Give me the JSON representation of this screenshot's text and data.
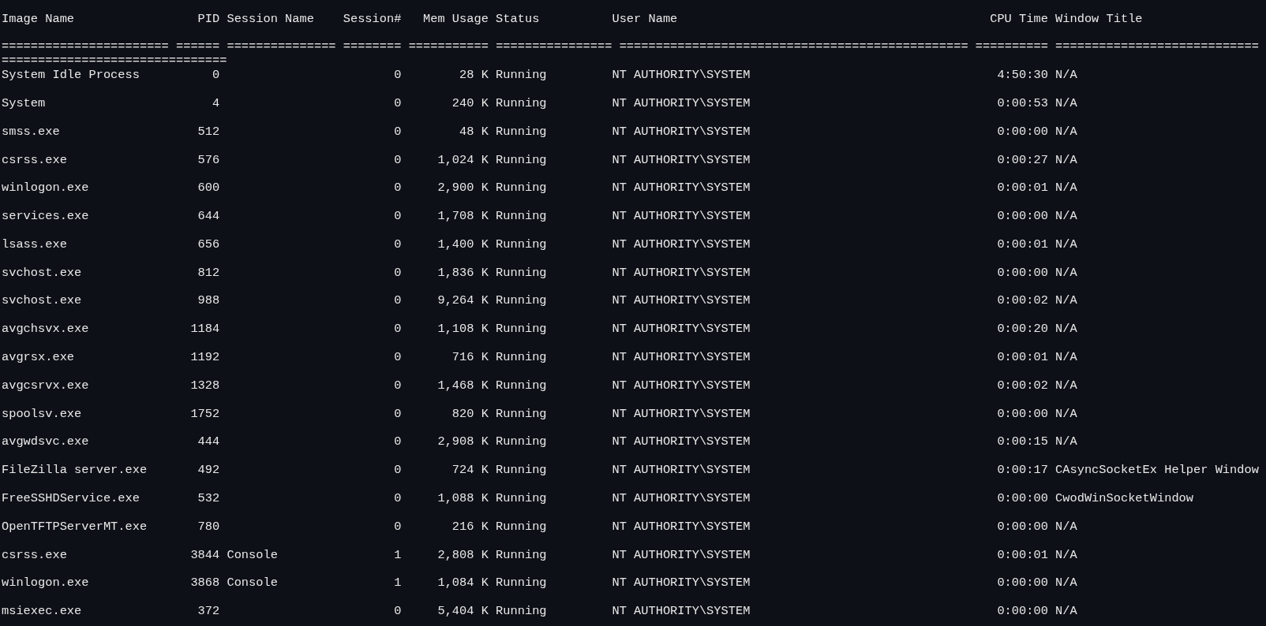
{
  "columns": [
    "Image Name",
    "PID",
    "Session Name",
    "Session#",
    "Mem Usage",
    "Status",
    "User Name",
    "CPU Time",
    "Window Title"
  ],
  "separator_lines": [
    "======================= ====== =============== ======== =========== ================ ================================================ ========== ============================",
    "==============================="
  ],
  "rows": [
    {
      "image_name": "System Idle Process",
      "pid": "0",
      "session_number": "0",
      "mem_usage": "28 K",
      "status": "Running",
      "user_name": "NT AUTHORITY\\SYSTEM",
      "cpu_time": "4:50:30",
      "window_title": "N/A"
    },
    {
      "image_name": "System",
      "pid": "4",
      "session_number": "0",
      "mem_usage": "240 K",
      "status": "Running",
      "user_name": "NT AUTHORITY\\SYSTEM",
      "cpu_time": "0:00:53",
      "window_title": "N/A"
    },
    {
      "image_name": "smss.exe",
      "pid": "512",
      "session_number": "0",
      "mem_usage": "48 K",
      "status": "Running",
      "user_name": "NT AUTHORITY\\SYSTEM",
      "cpu_time": "0:00:00",
      "window_title": "N/A"
    },
    {
      "image_name": "csrss.exe",
      "pid": "576",
      "session_number": "0",
      "mem_usage": "1,024 K",
      "status": "Running",
      "user_name": "NT AUTHORITY\\SYSTEM",
      "cpu_time": "0:00:27",
      "window_title": "N/A"
    },
    {
      "image_name": "winlogon.exe",
      "pid": "600",
      "session_number": "0",
      "mem_usage": "2,900 K",
      "status": "Running",
      "user_name": "NT AUTHORITY\\SYSTEM",
      "cpu_time": "0:00:01",
      "window_title": "N/A"
    },
    {
      "image_name": "services.exe",
      "pid": "644",
      "session_number": "0",
      "mem_usage": "1,708 K",
      "status": "Running",
      "user_name": "NT AUTHORITY\\SYSTEM",
      "cpu_time": "0:00:00",
      "window_title": "N/A"
    },
    {
      "image_name": "lsass.exe",
      "pid": "656",
      "session_number": "0",
      "mem_usage": "1,400 K",
      "status": "Running",
      "user_name": "NT AUTHORITY\\SYSTEM",
      "cpu_time": "0:00:01",
      "window_title": "N/A"
    },
    {
      "image_name": "svchost.exe",
      "pid": "812",
      "session_number": "0",
      "mem_usage": "1,836 K",
      "status": "Running",
      "user_name": "NT AUTHORITY\\SYSTEM",
      "cpu_time": "0:00:00",
      "window_title": "N/A"
    },
    {
      "image_name": "svchost.exe",
      "pid": "988",
      "session_number": "0",
      "mem_usage": "9,264 K",
      "status": "Running",
      "user_name": "NT AUTHORITY\\SYSTEM",
      "cpu_time": "0:00:02",
      "window_title": "N/A"
    },
    {
      "image_name": "avgchsvx.exe",
      "pid": "1184",
      "session_number": "0",
      "mem_usage": "1,108 K",
      "status": "Running",
      "user_name": "NT AUTHORITY\\SYSTEM",
      "cpu_time": "0:00:20",
      "window_title": "N/A"
    },
    {
      "image_name": "avgrsx.exe",
      "pid": "1192",
      "session_number": "0",
      "mem_usage": "716 K",
      "status": "Running",
      "user_name": "NT AUTHORITY\\SYSTEM",
      "cpu_time": "0:00:01",
      "window_title": "N/A"
    },
    {
      "image_name": "avgcsrvx.exe",
      "pid": "1328",
      "session_number": "0",
      "mem_usage": "1,468 K",
      "status": "Running",
      "user_name": "NT AUTHORITY\\SYSTEM",
      "cpu_time": "0:00:02",
      "window_title": "N/A"
    },
    {
      "image_name": "spoolsv.exe",
      "pid": "1752",
      "session_number": "0",
      "mem_usage": "820 K",
      "status": "Running",
      "user_name": "NT AUTHORITY\\SYSTEM",
      "cpu_time": "0:00:00",
      "window_title": "N/A"
    },
    {
      "image_name": "avgwdsvc.exe",
      "pid": "444",
      "session_number": "0",
      "mem_usage": "2,908 K",
      "status": "Running",
      "user_name": "NT AUTHORITY\\SYSTEM",
      "cpu_time": "0:00:15",
      "window_title": "N/A"
    },
    {
      "image_name": "FileZilla server.exe",
      "pid": "492",
      "session_number": "0",
      "mem_usage": "724 K",
      "status": "Running",
      "user_name": "NT AUTHORITY\\SYSTEM",
      "cpu_time": "0:00:17",
      "window_title": "CAsyncSocketEx Helper Window"
    },
    {
      "image_name": "FreeSSHDService.exe",
      "pid": "532",
      "session_number": "0",
      "mem_usage": "1,088 K",
      "status": "Running",
      "user_name": "NT AUTHORITY\\SYSTEM",
      "cpu_time": "0:00:00",
      "window_title": "CwodWinSocketWindow"
    },
    {
      "image_name": "OpenTFTPServerMT.exe",
      "pid": "780",
      "session_number": "0",
      "mem_usage": "216 K",
      "status": "Running",
      "user_name": "NT AUTHORITY\\SYSTEM",
      "cpu_time": "0:00:00",
      "window_title": "N/A"
    },
    {
      "image_name": "csrss.exe",
      "pid": "3844",
      "session_name": "Console",
      "session_number": "1",
      "mem_usage": "2,808 K",
      "status": "Running",
      "user_name": "NT AUTHORITY\\SYSTEM",
      "cpu_time": "0:00:01",
      "window_title": "N/A"
    },
    {
      "image_name": "winlogon.exe",
      "pid": "3868",
      "session_name": "Console",
      "session_number": "1",
      "mem_usage": "1,084 K",
      "status": "Running",
      "user_name": "NT AUTHORITY\\SYSTEM",
      "cpu_time": "0:00:00",
      "window_title": "N/A"
    },
    {
      "image_name": "msiexec.exe",
      "pid": "372",
      "session_number": "0",
      "mem_usage": "5,404 K",
      "status": "Running",
      "user_name": "NT AUTHORITY\\SYSTEM",
      "cpu_time": "0:00:00",
      "window_title": "N/A"
    }
  ]
}
